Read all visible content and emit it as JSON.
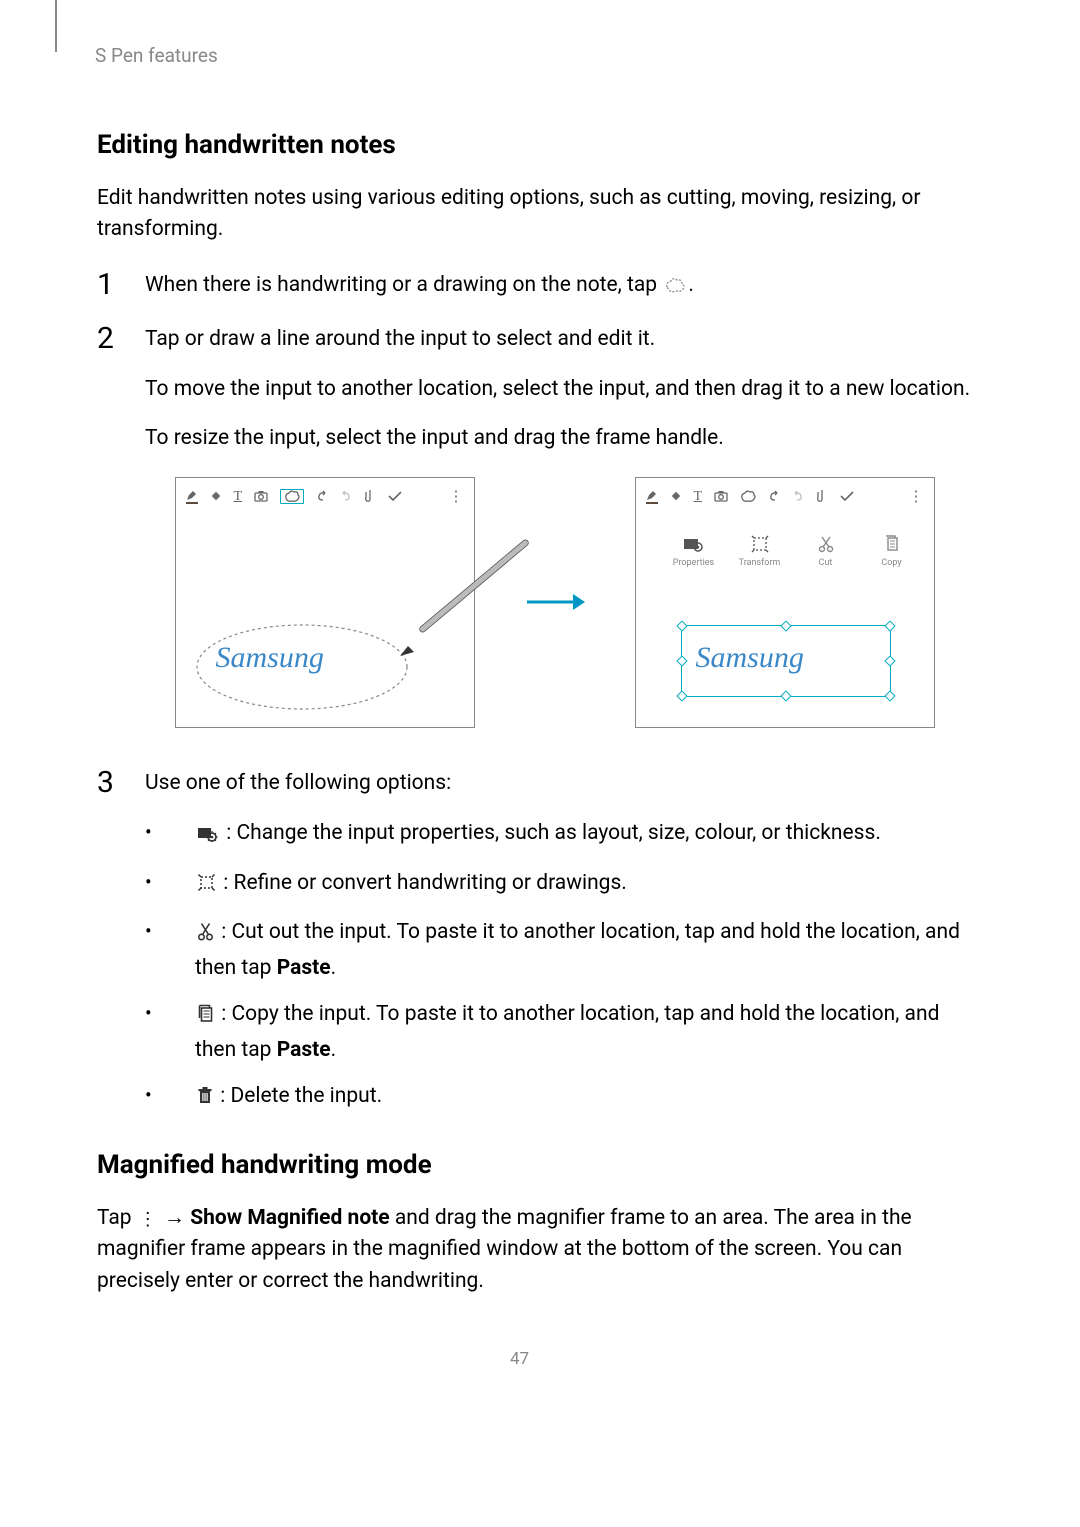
{
  "header": {
    "section": "S Pen features"
  },
  "h2_editing": "Editing handwritten notes",
  "p_editing_intro": "Edit handwritten notes using various editing options, such as cutting, moving, resizing, or transforming.",
  "steps": {
    "s1": {
      "num": "1",
      "text_before_icon": "When there is handwriting or a drawing on the note, tap ",
      "text_after_icon": "."
    },
    "s2": {
      "num": "2",
      "p1": "Tap or draw a line around the input to select and edit it.",
      "p2": "To move the input to another location, select the input, and then drag it to a new location.",
      "p3": "To resize the input, select the input and drag the frame handle."
    },
    "s3": {
      "num": "3",
      "p1": "Use one of the following options:",
      "bullets": {
        "b1": " : Change the input properties, such as layout, size, colour, or thickness.",
        "b2": " : Refine or convert handwriting or drawings.",
        "b3_a": " : Cut out the input. To paste it to another location, tap and hold the location, and then tap ",
        "b3_bold": "Paste",
        "b3_b": ".",
        "b4_a": " : Copy the input. To paste it to another location, tap and hold the location, and then tap ",
        "b4_bold": "Paste",
        "b4_b": ".",
        "b5": " : Delete the input."
      }
    }
  },
  "figure": {
    "handwriting_text": "Samsung",
    "float_labels": {
      "properties": "Properties",
      "transform": "Transform",
      "cut": "Cut",
      "copy": "Copy"
    }
  },
  "h2_magnified": "Magnified handwriting mode",
  "p_magnified_a": "Tap ",
  "p_magnified_b": " → ",
  "p_magnified_bold": "Show Magnified note",
  "p_magnified_c": " and drag the magnifier frame to an area. The area in the magnifier frame appears in the magnified window at the bottom of the screen. You can precisely enter or correct the handwriting.",
  "page_number": "47"
}
